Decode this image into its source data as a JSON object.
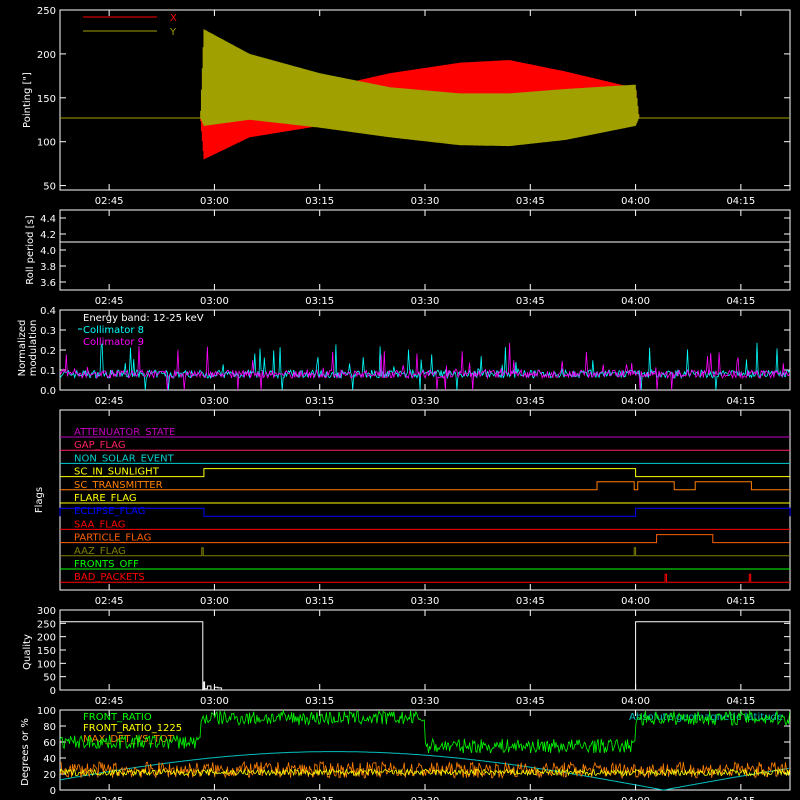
{
  "time_axis": {
    "range": [
      "02:38",
      "04:22"
    ],
    "tick_labels": [
      "02:45",
      "03:00",
      "03:15",
      "03:30",
      "03:45",
      "04:00",
      "04:15"
    ],
    "tick_values_minutes": [
      165,
      180,
      195,
      210,
      225,
      240,
      255
    ]
  },
  "chart_data": [
    {
      "type": "line",
      "ylabel": "Pointing [\"]",
      "ylim": [
        45,
        250
      ],
      "yticks": [
        50,
        100,
        150,
        200,
        250
      ],
      "legend_placement": "top-left",
      "series": [
        {
          "name": "X",
          "color": "#ff0000",
          "note_values": "envelope (min/max) vs time in minutes",
          "t": [
            158,
            178,
            178.5,
            185,
            195,
            205,
            215,
            222,
            230,
            240,
            240.5,
            262
          ],
          "min": [
            127,
            127,
            80,
            105,
            118,
            128,
            137,
            140,
            137,
            128,
            127,
            127
          ],
          "max": [
            127,
            127,
            126,
            128,
            160,
            178,
            190,
            193,
            180,
            161,
            127,
            127
          ]
        },
        {
          "name": "Y",
          "color": "#a0a000",
          "t": [
            158,
            178,
            178.5,
            185,
            195,
            205,
            215,
            222,
            230,
            240,
            240.5,
            262
          ],
          "min": [
            127,
            127,
            118,
            125,
            116,
            105,
            96,
            95,
            102,
            118,
            127,
            127
          ],
          "max": [
            127,
            127,
            228,
            200,
            178,
            162,
            155,
            155,
            160,
            165,
            127,
            127
          ]
        }
      ]
    },
    {
      "type": "line",
      "ylabel": "Roll period [s]",
      "ylim": [
        3.5,
        4.5
      ],
      "yticks": [
        3.6,
        3.8,
        4.0,
        4.2,
        4.4
      ],
      "series": [
        {
          "color": "#ffffff",
          "x": [
            158,
            262
          ],
          "values": [
            4.1,
            4.1
          ]
        }
      ]
    },
    {
      "type": "line",
      "ylabel_lines": [
        "Normalized",
        "modulation"
      ],
      "ylim": [
        0,
        0.4
      ],
      "yticks": [
        0.0,
        0.1,
        0.2,
        0.3,
        0.4
      ],
      "legend_title": "Energy band: 12-25 keV",
      "legend_placement": "top-left",
      "series": [
        {
          "name": "Collimator 8",
          "color": "#00ffff",
          "baseline": 0.08
        },
        {
          "name": "Collimator 9",
          "color": "#ff00ff",
          "baseline": 0.08
        }
      ]
    },
    {
      "type": "step",
      "ylabel": "Flags",
      "flags": [
        {
          "name": "ATTENUATOR_STATE",
          "color": "#c000c0",
          "high": []
        },
        {
          "name": "GAP_FLAG",
          "color": "#ff2060",
          "high": []
        },
        {
          "name": "NON_SOLAR_EVENT",
          "color": "#00d0d0",
          "high": []
        },
        {
          "name": "SC_IN_SUNLIGHT",
          "color": "#ffff00",
          "high": [
            [
              178.5,
              240
            ]
          ]
        },
        {
          "name": "SC_TRANSMITTER",
          "color": "#ff8000",
          "high": [
            [
              234.5,
              239.8
            ],
            [
              240.3,
              245.5
            ],
            [
              248.5,
              256.5
            ]
          ]
        },
        {
          "name": "FLARE_FLAG",
          "color": "#ffff00",
          "high": []
        },
        {
          "name": "ECLIPSE_FLAG",
          "color": "#0000ff",
          "high": [
            [
              158,
              178.5
            ],
            [
              240,
              262
            ]
          ]
        },
        {
          "name": "SAA_FLAG",
          "color": "#ff0000",
          "high": []
        },
        {
          "name": "PARTICLE_FLAG",
          "color": "#ff6000",
          "high": [
            [
              243,
              251
            ]
          ]
        },
        {
          "name": "AAZ_FLAG",
          "color": "#808000",
          "high": [
            [
              178.2,
              178.4
            ],
            [
              239.8,
              240
            ]
          ]
        },
        {
          "name": "FRONTS_OFF",
          "color": "#00ff00",
          "high": []
        },
        {
          "name": "BAD_PACKETS",
          "color": "#ff0000",
          "high": [
            [
              244.2,
              244.4
            ],
            [
              256.2,
              256.4
            ]
          ]
        }
      ]
    },
    {
      "type": "line",
      "ylabel": "Quality",
      "ylim": [
        0,
        300
      ],
      "yticks": [
        0,
        50,
        100,
        150,
        200,
        250,
        300
      ],
      "series": [
        {
          "color": "#ffffff",
          "x": [
            158,
            178.3,
            178.35,
            178.5,
            178.6,
            179,
            179.5,
            180,
            180.5,
            181,
            239.9,
            240,
            262
          ],
          "values": [
            256,
            256,
            0,
            30,
            5,
            15,
            0,
            10,
            8,
            0,
            0,
            256,
            256
          ]
        }
      ]
    },
    {
      "type": "line",
      "ylabel": "Degrees or %",
      "ylim": [
        0,
        100
      ],
      "yticks": [
        0,
        20,
        40,
        60,
        80,
        100
      ],
      "legend_placement": "top-left",
      "series": [
        {
          "name": "FRONT_RATIO",
          "color": "#00ff00"
        },
        {
          "name": "FRONT_RATIO_1225",
          "color": "#ffff00"
        },
        {
          "name": "MAX_DET_VS_TOT",
          "color": "#ff8000"
        },
        {
          "name": "Absolute geomagnetic latitude",
          "color": "#00c0c0"
        }
      ]
    }
  ]
}
